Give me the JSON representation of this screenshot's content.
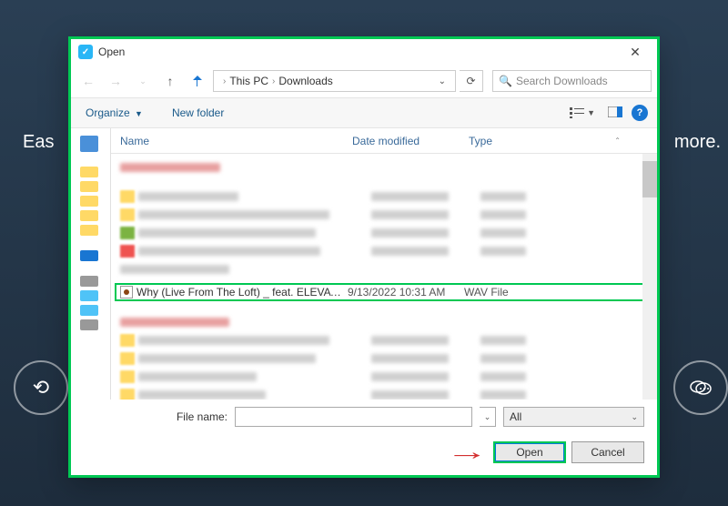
{
  "bg": {
    "left": "Eas",
    "right": "more."
  },
  "titlebar": {
    "title": "Open",
    "close": "✕"
  },
  "nav": {
    "thispc": "This PC",
    "folder": "Downloads"
  },
  "search": {
    "placeholder": "Search Downloads"
  },
  "toolbar": {
    "organize": "Organize",
    "newfolder": "New folder"
  },
  "columns": {
    "name": "Name",
    "date": "Date modified",
    "type": "Type"
  },
  "selected": {
    "name": "Why (Live From The Loft) _ feat. ELEVATI...",
    "date": "9/13/2022 10:31 AM",
    "type": "WAV File"
  },
  "bottom": {
    "filename_label": "File name:",
    "filename_value": "",
    "filter": "All",
    "open": "Open",
    "cancel": "Cancel"
  }
}
